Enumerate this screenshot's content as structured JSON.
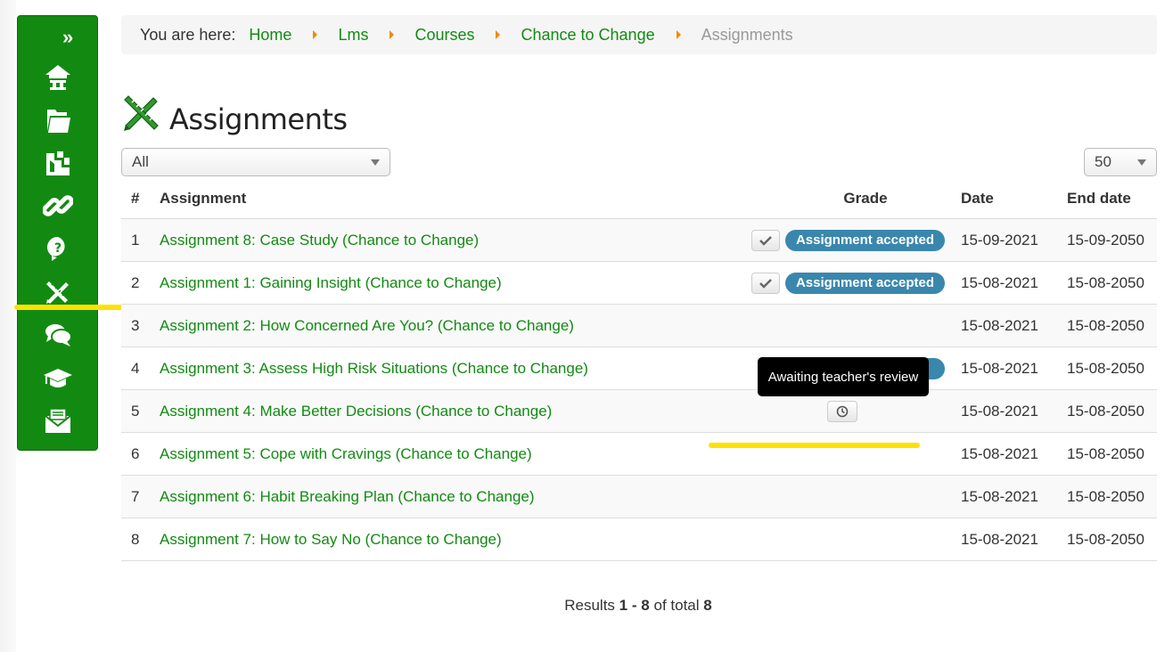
{
  "sidebar": {
    "collapse_label": "»",
    "items": [
      {
        "name": "home"
      },
      {
        "name": "documents"
      },
      {
        "name": "courses"
      },
      {
        "name": "links"
      },
      {
        "name": "help"
      },
      {
        "name": "assignments"
      },
      {
        "name": "forum"
      },
      {
        "name": "learning-path"
      },
      {
        "name": "messages"
      }
    ]
  },
  "breadcrumb": {
    "prefix": "You are here:",
    "links": [
      "Home",
      "Lms",
      "Courses",
      "Chance to Change"
    ],
    "current": "Assignments"
  },
  "page": {
    "title": "Assignments",
    "filter_value": "All",
    "per_page_value": "50"
  },
  "table": {
    "headers": {
      "num": "#",
      "assignment": "Assignment",
      "grade": "Grade",
      "date": "Date",
      "end_date": "End date"
    },
    "rows": [
      {
        "num": "1",
        "name": "Assignment 8: Case Study (Chance to Change)",
        "status": "Assignment accepted",
        "date": "15-09-2021",
        "end": "15-09-2050"
      },
      {
        "num": "2",
        "name": "Assignment 1: Gaining Insight (Chance to Change)",
        "status": "Assignment accepted",
        "date": "15-08-2021",
        "end": "15-08-2050"
      },
      {
        "num": "3",
        "name": "Assignment 2: How Concerned Are You? (Chance to Change)",
        "status": "",
        "date": "15-08-2021",
        "end": "15-08-2050"
      },
      {
        "num": "4",
        "name": "Assignment 3: Assess High Risk Situations (Chance to Change)",
        "status": "",
        "date": "15-08-2021",
        "end": "15-08-2050"
      },
      {
        "num": "5",
        "name": "Assignment 4: Make Better Decisions (Chance to Change)",
        "status": "",
        "date": "15-08-2021",
        "end": "15-08-2050"
      },
      {
        "num": "6",
        "name": "Assignment 5: Cope with Cravings (Chance to Change)",
        "status": "",
        "date": "15-08-2021",
        "end": "15-08-2050"
      },
      {
        "num": "7",
        "name": "Assignment 6: Habit Breaking Plan (Chance to Change)",
        "status": "",
        "date": "15-08-2021",
        "end": "15-08-2050"
      },
      {
        "num": "8",
        "name": "Assignment 7: How to Say No (Chance to Change)",
        "status": "",
        "date": "15-08-2021",
        "end": "15-08-2050"
      }
    ]
  },
  "tooltip": {
    "text": "Awaiting teacher's review"
  },
  "results": {
    "prefix": "Results",
    "from": "1",
    "dash": "-",
    "to": "8",
    "of_total": "of total",
    "total": "8"
  },
  "colors": {
    "brand_green": "#128a12",
    "badge_blue": "#3a87ad",
    "highlight_yellow": "#ffe100",
    "breadcrumb_arrow": "#f08a00"
  }
}
